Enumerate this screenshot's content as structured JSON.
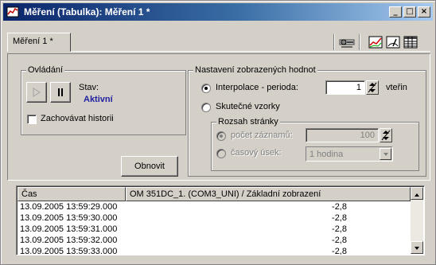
{
  "window": {
    "title": "Měření (Tabulka): Měření 1 *",
    "buttons": {
      "minimize": "_",
      "maximize": "□",
      "close": "×"
    }
  },
  "tabs": [
    {
      "label": "Měření 1 *"
    }
  ],
  "toolbar": {
    "icons": [
      "settings-icon",
      "chart-view-icon",
      "gauge-view-icon",
      "table-view-icon"
    ]
  },
  "controls": {
    "legend": "Ovládání",
    "status_label": "Stav:",
    "status_value": "Aktivní",
    "status_color": "#1f1fa0",
    "keep_history_label": "Zachovávat historii",
    "refresh_button": "Obnovit"
  },
  "display_settings": {
    "legend": "Nastavení zobrazených hodnot",
    "interpolation_label": "Interpolace - perioda:",
    "interpolation_value": "1",
    "interpolation_unit": "vteřin",
    "real_samples_label": "Skutečné vzorky",
    "page_range": {
      "legend": "Rozsah stránky",
      "record_count_label": "počet záznamů:",
      "record_count_value": "100",
      "time_span_label": "časový úsek:",
      "time_span_value": "1 hodina"
    }
  },
  "table": {
    "columns": [
      "Čas",
      "OM 351DC_1. (COM3_UNI) / Základní zobrazení"
    ],
    "rows": [
      {
        "time": "13.09.2005 13:59:29.000",
        "value": "-2,8"
      },
      {
        "time": "13.09.2005 13:59:30.000",
        "value": "-2,8"
      },
      {
        "time": "13.09.2005 13:59:31.000",
        "value": "-2,8"
      },
      {
        "time": "13.09.2005 13:59:32.000",
        "value": "-2,8"
      },
      {
        "time": "13.09.2005 13:59:33.000",
        "value": "-2,8"
      }
    ]
  }
}
